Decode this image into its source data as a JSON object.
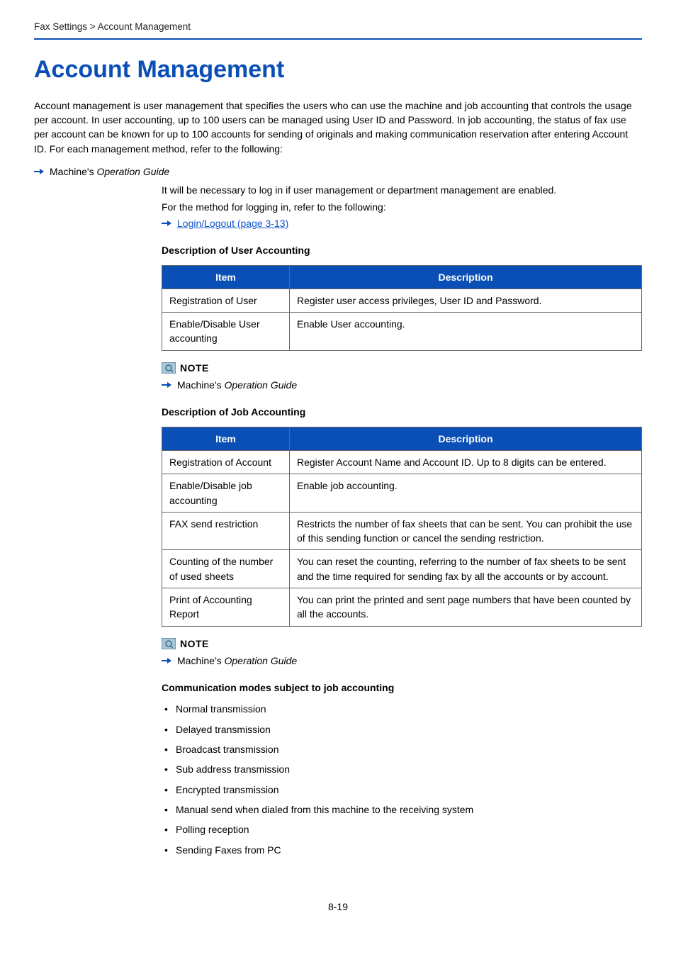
{
  "breadcrumb": "Fax Settings > Account Management",
  "title": "Account Management",
  "intro": "Account management is user management that specifies the users who can use the machine and job accounting that controls the usage per account. In user accounting, up to 100 users can be managed using User ID and Password. In job accounting, the status of fax use per account can be known for up to 100 accounts for sending of originals and making communication reservation after entering Account ID. For each management method, refer to the following:",
  "guide_prefix": "Machine's ",
  "guide_title": "Operation Guide",
  "login_note_1": "It will be necessary to log in if user management or department management are enabled.",
  "login_note_2": "For the method for logging in, refer to the following:",
  "login_link": "Login/Logout (page 3-13)",
  "user_accounting_heading": "Description of User Accounting",
  "table_headers": {
    "item": "Item",
    "description": "Description"
  },
  "user_table": [
    {
      "item": "Registration of User",
      "desc": "Register user access privileges, User ID and Password."
    },
    {
      "item": "Enable/Disable User accounting",
      "desc": "Enable User accounting."
    }
  ],
  "note_label": "NOTE",
  "job_accounting_heading": "Description of Job Accounting",
  "job_table": [
    {
      "item": "Registration of Account",
      "desc": "Register Account Name and Account ID. Up to 8 digits can be entered."
    },
    {
      "item": "Enable/Disable job accounting",
      "desc": "Enable job accounting."
    },
    {
      "item": "FAX send restriction",
      "desc": "Restricts the number of fax sheets that can be sent. You can prohibit the use of this sending function or cancel the sending restriction."
    },
    {
      "item": "Counting of the number of used sheets",
      "desc": "You can reset the counting, referring to the number of fax sheets to be sent and the time required for sending fax by all the accounts or by account."
    },
    {
      "item": "Print of Accounting Report",
      "desc": "You can print the printed and sent page numbers that have been counted by all the accounts."
    }
  ],
  "comm_modes_heading": "Communication modes subject to job accounting",
  "comm_modes": [
    "Normal transmission",
    "Delayed transmission",
    "Broadcast transmission",
    "Sub address transmission",
    "Encrypted transmission",
    "Manual send when dialed from this machine to the receiving system",
    "Polling reception",
    "Sending Faxes from PC"
  ],
  "page_number": "8-19"
}
